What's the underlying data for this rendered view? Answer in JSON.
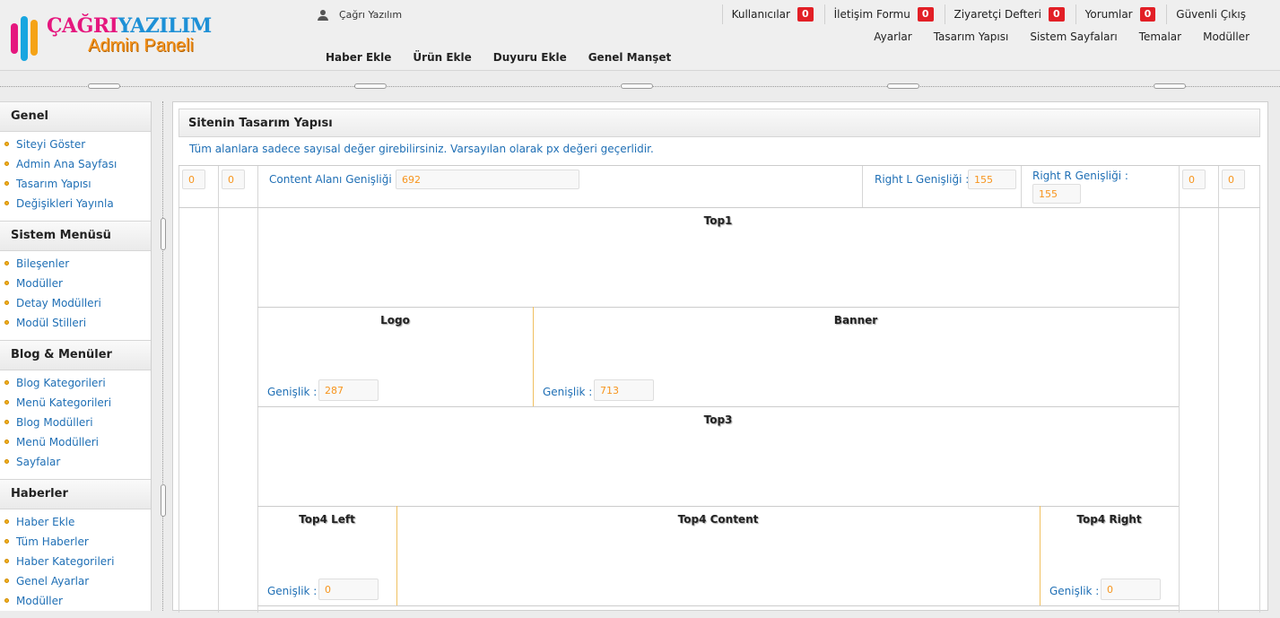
{
  "brand": {
    "name_part1": "ÇAĞRI",
    "name_part2": "YAZILIM",
    "subtitle": "Admin Paneli"
  },
  "user": {
    "name": "Çağrı Yazılım"
  },
  "topnav": [
    {
      "label": "Kullanıcılar",
      "count": "0"
    },
    {
      "label": "İletişim Formu",
      "count": "0"
    },
    {
      "label": "Ziyaretçi Defteri",
      "count": "0"
    },
    {
      "label": "Yorumlar",
      "count": "0"
    },
    {
      "label": "Güvenli Çıkış"
    }
  ],
  "subnav": [
    "Ayarlar",
    "Tasarım Yapısı",
    "Sistem Sayfaları",
    "Temalar",
    "Modüller"
  ],
  "quicknav": [
    "Haber Ekle",
    "Ürün Ekle",
    "Duyuru Ekle",
    "Genel Manşet"
  ],
  "sidebar": [
    {
      "title": "Genel",
      "items": [
        "Siteyi Göster",
        "Admin Ana Sayfası",
        "Tasarım Yapısı",
        "Değişikleri Yayınla"
      ]
    },
    {
      "title": "Sistem Menüsü",
      "items": [
        "Bileşenler",
        "Modüller",
        "Detay Modülleri",
        "Modül Stilleri"
      ]
    },
    {
      "title": "Blog & Menüler",
      "items": [
        "Blog Kategorileri",
        "Menü Kategorileri",
        "Blog Modülleri",
        "Menü Modülleri",
        "Sayfalar"
      ]
    },
    {
      "title": "Haberler",
      "items": [
        "Haber Ekle",
        "Tüm Haberler",
        "Haber Kategorileri",
        "Genel Ayarlar",
        "Modüller"
      ]
    }
  ],
  "main": {
    "title": "Sitenin Tasarım Yapısı",
    "info": "Tüm alanlara sadece sayısal değer girebilirsiniz. Varsayılan olarak px değeri geçerlidir.",
    "left_outer": "0",
    "left_inner": "0",
    "content_width_label": "Content Alanı Genişliği :",
    "content_width": "692",
    "right_l_label": "Right L Genişliği :",
    "right_l": "155",
    "right_r_label": "Right R Genişliği :",
    "right_r": "155",
    "right_inner": "0",
    "right_outer": "0",
    "width_label": "Genişlik :",
    "top1": "Top1",
    "logo": "Logo",
    "logo_width": "287",
    "banner": "Banner",
    "banner_width": "713",
    "top3": "Top3",
    "top4_left": "Top4 Left",
    "top4_left_width": "0",
    "top4_content": "Top4 Content",
    "top4_right": "Top4 Right",
    "top4_right_width": "0"
  }
}
